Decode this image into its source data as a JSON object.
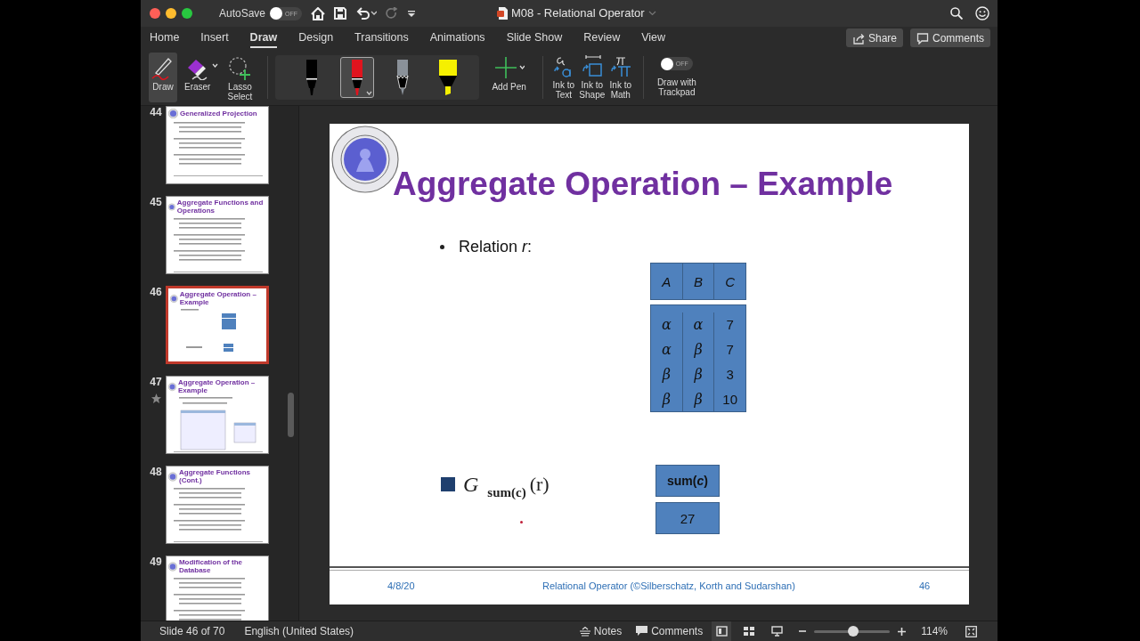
{
  "window": {
    "title": "M08 - Relational Operator",
    "autosave": {
      "label": "AutoSave",
      "on": false,
      "state_text": "OFF"
    }
  },
  "menu_tabs": [
    {
      "label": "Home",
      "selected": false
    },
    {
      "label": "Insert",
      "selected": false
    },
    {
      "label": "Draw",
      "selected": true
    },
    {
      "label": "Design",
      "selected": false
    },
    {
      "label": "Transitions",
      "selected": false
    },
    {
      "label": "Animations",
      "selected": false
    },
    {
      "label": "Slide Show",
      "selected": false
    },
    {
      "label": "Review",
      "selected": false
    },
    {
      "label": "View",
      "selected": false
    }
  ],
  "header_buttons": [
    {
      "kind": "share",
      "label": "Share"
    },
    {
      "kind": "comments",
      "label": "Comments"
    }
  ],
  "ribbon": {
    "tools": [
      {
        "kind": "draw",
        "label": "Draw",
        "selected": true
      },
      {
        "kind": "eraser",
        "label": "Eraser",
        "selected": false
      },
      {
        "kind": "lasso",
        "label": "Lasso Select",
        "selected": false
      }
    ],
    "pens": [
      {
        "kind": "pen",
        "color": "#000000",
        "selected": false
      },
      {
        "kind": "pen",
        "color": "#e0141e",
        "selected": true
      },
      {
        "kind": "pencil",
        "color": "#8a9199",
        "selected": false
      },
      {
        "kind": "highlighter",
        "color": "#f5f000",
        "selected": false
      }
    ],
    "add_pen": "Add Pen",
    "ink_tools": [
      {
        "kind": "text",
        "label": "Ink to Text"
      },
      {
        "kind": "shape",
        "label": "Ink to Shape"
      },
      {
        "kind": "math",
        "label": "Ink to Math"
      }
    ],
    "trackpad": {
      "label": "Draw with Trackpad",
      "on": false,
      "state_text": "OFF"
    }
  },
  "thumbnails": [
    {
      "number": "44",
      "title": "Generalized Projection",
      "kind": "text",
      "selected": false,
      "starred": false
    },
    {
      "number": "45",
      "title": "Aggregate Functions and Operations",
      "kind": "text",
      "selected": false,
      "starred": false
    },
    {
      "number": "46",
      "title": "Aggregate Operation – Example",
      "kind": "example",
      "selected": true,
      "starred": false
    },
    {
      "number": "47",
      "title": "Aggregate Operation – Example",
      "kind": "table",
      "selected": false,
      "starred": true
    },
    {
      "number": "48",
      "title": "Aggregate Functions (Cont.)",
      "kind": "text",
      "selected": false,
      "starred": false
    },
    {
      "number": "49",
      "title": "Modification of the Database",
      "kind": "text",
      "selected": false,
      "starred": false
    }
  ],
  "slide": {
    "title": "Aggregate Operation – Example",
    "bullet": "Relation *r*:",
    "relation": {
      "columns": [
        "A",
        "B",
        "C"
      ],
      "rows": [
        [
          "α",
          "α",
          "7"
        ],
        [
          "α",
          "β",
          "7"
        ],
        [
          "β",
          "β",
          "3"
        ],
        [
          "β",
          "β",
          "10"
        ]
      ]
    },
    "expression": {
      "operator": "G",
      "subscript": "sum(c)",
      "argument": "(r)"
    },
    "result": {
      "columns": [
        "sum(*c*)"
      ],
      "rows": [
        [
          "27"
        ]
      ]
    },
    "footer": {
      "date": "4/8/20",
      "center": "Relational Operator (©Silberschatz, Korth and Sudarshan)",
      "page": "46"
    }
  },
  "status_bar": {
    "slide_info": "Slide 46 of 70",
    "language": "English (United States)",
    "notes": "Notes",
    "comments": "Comments",
    "views": [
      {
        "kind": "normal",
        "selected": true
      },
      {
        "kind": "sorter",
        "selected": false
      },
      {
        "kind": "reading",
        "selected": false
      }
    ],
    "zoom": {
      "level": 0.52,
      "text": "114%"
    }
  }
}
